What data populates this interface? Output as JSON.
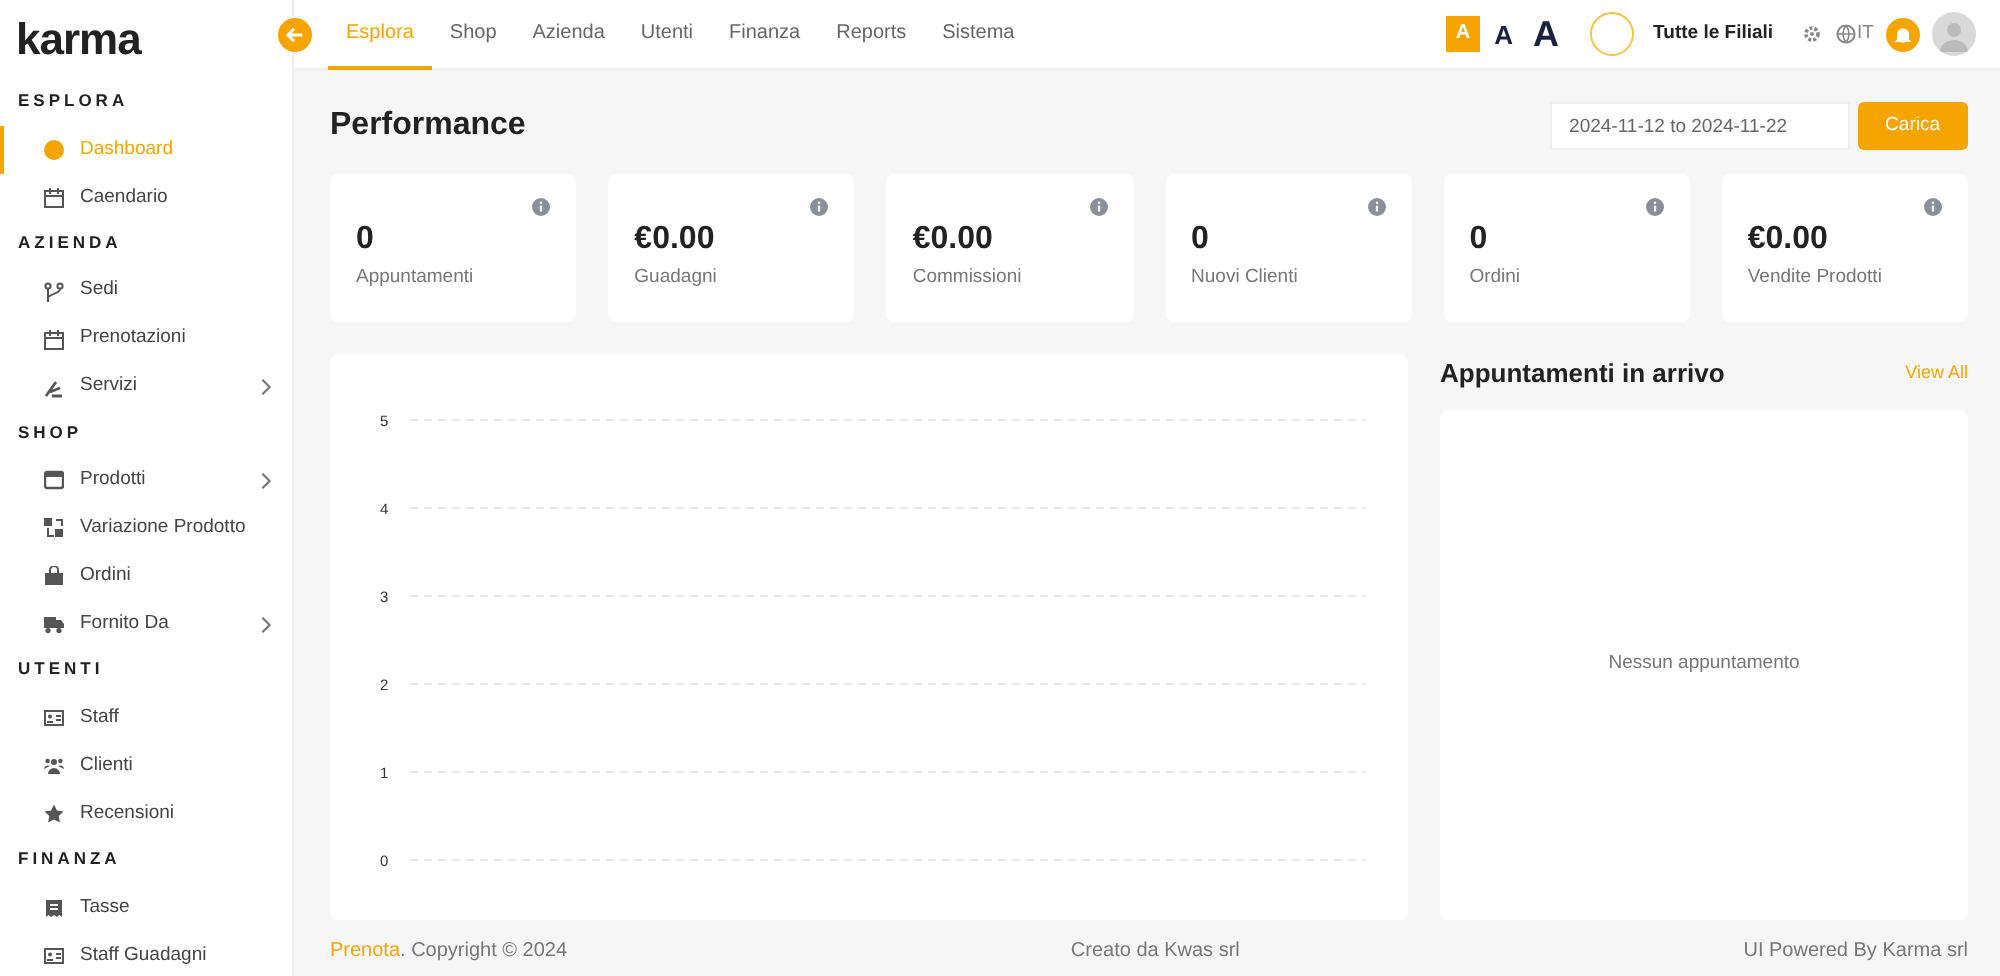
{
  "logo": {
    "text": "karma"
  },
  "topnav": {
    "tabs": [
      {
        "label": "Esplora",
        "selected": true
      },
      {
        "label": "Shop",
        "selected": false
      },
      {
        "label": "Azienda",
        "selected": false
      },
      {
        "label": "Utenti",
        "selected": false
      },
      {
        "label": "Finanza",
        "selected": false
      },
      {
        "label": "Reports",
        "selected": false
      },
      {
        "label": "Sistema",
        "selected": false
      }
    ],
    "font_sizes": [
      {
        "label": "A",
        "selected": true
      },
      {
        "label": "A",
        "selected": false
      },
      {
        "label": "A",
        "selected": false
      }
    ],
    "branch": "Tutte le Filiali",
    "language": "IT"
  },
  "sidebar": {
    "sections": [
      {
        "title": "ESPLORA",
        "items": [
          {
            "label": "Dashboard",
            "selected": true,
            "submenu": false
          },
          {
            "label": "Caendario",
            "selected": false,
            "submenu": false
          }
        ]
      },
      {
        "title": "AZIENDA",
        "items": [
          {
            "label": "Sedi",
            "selected": false,
            "submenu": false
          },
          {
            "label": "Prenotazioni",
            "selected": false,
            "submenu": false
          },
          {
            "label": "Servizi",
            "selected": false,
            "submenu": true
          }
        ]
      },
      {
        "title": "SHOP",
        "items": [
          {
            "label": "Prodotti",
            "selected": false,
            "submenu": true
          },
          {
            "label": "Variazione Prodotto",
            "selected": false,
            "submenu": false
          },
          {
            "label": "Ordini",
            "selected": false,
            "submenu": false
          },
          {
            "label": "Fornito Da",
            "selected": false,
            "submenu": true
          }
        ]
      },
      {
        "title": "UTENTI",
        "items": [
          {
            "label": "Staff",
            "selected": false,
            "submenu": false
          },
          {
            "label": "Clienti",
            "selected": false,
            "submenu": false
          },
          {
            "label": "Recensioni",
            "selected": false,
            "submenu": false
          }
        ]
      },
      {
        "title": "FINANZA",
        "items": [
          {
            "label": "Tasse",
            "selected": false,
            "submenu": false
          },
          {
            "label": "Staff Guadagni",
            "selected": false,
            "submenu": false
          }
        ]
      }
    ]
  },
  "page": {
    "title": "Performance",
    "date_range": "2024-11-12 to 2024-11-22",
    "load_button": "Carica"
  },
  "stats": [
    {
      "value": "0",
      "label": "Appuntamenti"
    },
    {
      "value": "€0.00",
      "label": "Guadagni"
    },
    {
      "value": "€0.00",
      "label": "Commissioni"
    },
    {
      "value": "0",
      "label": "Nuovi Clienti"
    },
    {
      "value": "0",
      "label": "Ordini"
    },
    {
      "value": "€0.00",
      "label": "Vendite Prodotti"
    }
  ],
  "chart": {
    "y_axis_labels": [
      "5",
      "4",
      "3",
      "2",
      "1",
      "0"
    ]
  },
  "upcoming": {
    "title": "Appuntamenti in arrivo",
    "view_all": "View All",
    "empty": "Nessun appuntamento"
  },
  "footer": {
    "link": "Prenota",
    "copyright": ". Copyright © 2024",
    "credit": "Creato da Kwas srl",
    "powered": "UI Powered By Karma srl"
  }
}
